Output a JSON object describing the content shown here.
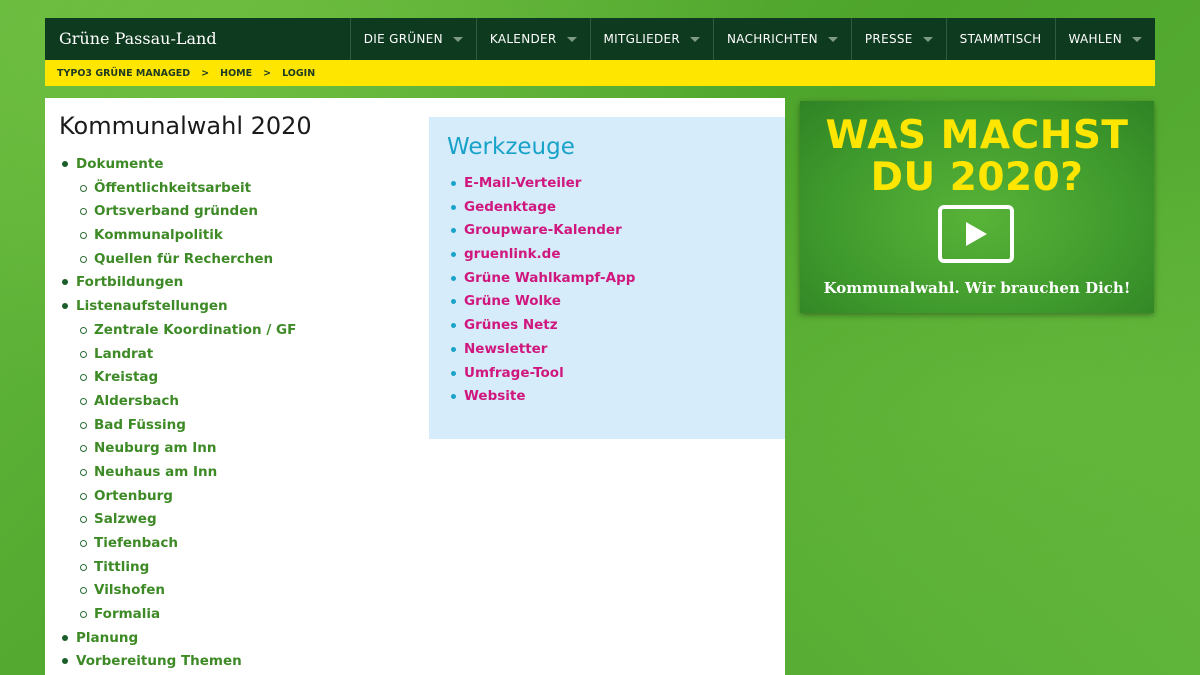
{
  "header": {
    "site_title": "Grüne Passau-Land",
    "menu": [
      {
        "label": "DIE GRÜNEN",
        "has_dropdown": true
      },
      {
        "label": "KALENDER",
        "has_dropdown": true
      },
      {
        "label": "MITGLIEDER",
        "has_dropdown": true
      },
      {
        "label": "NACHRICHTEN",
        "has_dropdown": true
      },
      {
        "label": "PRESSE",
        "has_dropdown": true
      },
      {
        "label": "STAMMTISCH",
        "has_dropdown": false
      },
      {
        "label": "WAHLEN",
        "has_dropdown": true
      }
    ]
  },
  "breadcrumb": {
    "items": [
      "TYPO3 GRÜNE MANAGED",
      "HOME",
      "LOGIN"
    ],
    "separator": ">"
  },
  "main": {
    "title": "Kommunalwahl 2020",
    "nav": [
      {
        "label": "Dokumente",
        "children": [
          "Öffentlichkeitsarbeit",
          "Ortsverband gründen",
          "Kommunalpolitik",
          "Quellen für Recherchen"
        ]
      },
      {
        "label": "Fortbildungen",
        "children": []
      },
      {
        "label": "Listenaufstellungen",
        "children": [
          "Zentrale Koordination / GF",
          "Landrat",
          "Kreistag",
          "Aldersbach",
          "Bad Füssing",
          "Neuburg am Inn",
          "Neuhaus am Inn",
          "Ortenburg",
          "Salzweg",
          "Tiefenbach",
          "Tittling",
          "Vilshofen",
          "Formalia"
        ]
      },
      {
        "label": "Planung",
        "children": []
      },
      {
        "label": "Vorbereitung Themen",
        "children": []
      }
    ]
  },
  "tools": {
    "title": "Werkzeuge",
    "links": [
      "E-Mail-Verteiler",
      "Gedenktage",
      "Groupware-Kalender",
      "gruenlink.de",
      "Grüne Wahlkampf-App",
      "Grüne Wolke",
      "Grünes Netz",
      "Newsletter",
      "Umfrage-Tool",
      "Website"
    ]
  },
  "promo": {
    "headline_line1": "WAS MACHST",
    "headline_line2": "DU 2020?",
    "tagline": "Kommunalwahl. Wir brauchen Dich!",
    "icon": "play-icon"
  },
  "colors": {
    "nav_bg": "#0e3a1f",
    "breadcrumb_bg": "#ffe600",
    "link_green": "#3d8a26",
    "link_magenta": "#d0177e",
    "tools_bg": "#d6ecfa",
    "tools_title": "#1aa3c9",
    "page_bg": "#5fb43a"
  }
}
